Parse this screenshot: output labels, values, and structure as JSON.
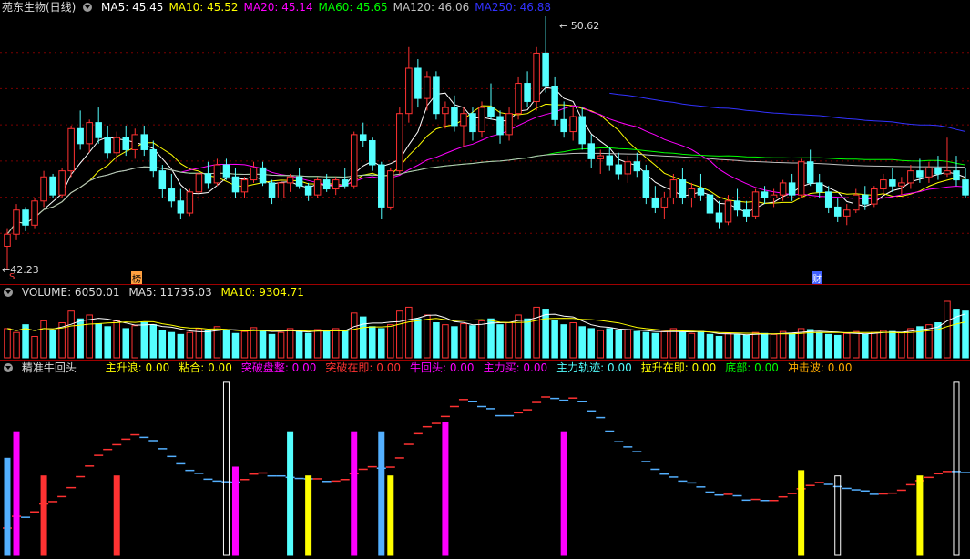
{
  "colors": {
    "up": "#ff3232",
    "down": "#54ffff",
    "ma5": "#ffffff",
    "ma10": "#ffff00",
    "ma20": "#ff00ff",
    "ma60": "#00ff00",
    "ma120": "#c0c0c0",
    "ma250": "#3232ff",
    "grid": "#7a0000",
    "border": "#a00000"
  },
  "price_panel": {
    "title": "苑东生物(日线)",
    "indicators": [
      {
        "label": "MA5: 45.45",
        "color": "#ffffff"
      },
      {
        "label": "MA10: 45.52",
        "color": "#ffff00"
      },
      {
        "label": "MA20: 45.14",
        "color": "#ff00ff"
      },
      {
        "label": "MA60: 45.65",
        "color": "#00ff00"
      },
      {
        "label": "MA120: 46.06",
        "color": "#c0c0c0"
      },
      {
        "label": "MA250: 46.88",
        "color": "#3232ff"
      }
    ],
    "high_label": "50.62",
    "low_label": "42.23",
    "event_markers": [
      "S",
      "榜",
      "财"
    ]
  },
  "volume_panel": {
    "title": "VOLUME: 6050.01",
    "ma5": "MA5: 11735.03",
    "ma10": "MA10: 9304.71"
  },
  "indicator_panel": {
    "title": "精准牛回头",
    "items": [
      {
        "label": "主升浪: 0.00",
        "color": "#ffff00"
      },
      {
        "label": "粘合: 0.00",
        "color": "#ffff00"
      },
      {
        "label": "突破盘整: 0.00",
        "color": "#ff00ff"
      },
      {
        "label": "突破在即: 0.00",
        "color": "#ff3232"
      },
      {
        "label": "牛回头: 0.00",
        "color": "#ff00ff"
      },
      {
        "label": "主力买: 0.00",
        "color": "#ff00ff"
      },
      {
        "label": "主力轨迹: 0.00",
        "color": "#54ffff"
      },
      {
        "label": "拉升在即: 0.00",
        "color": "#ffff00"
      },
      {
        "label": "底部: 0.00",
        "color": "#00ff00"
      },
      {
        "label": "冲击波: 0.00",
        "color": "#ffaa00"
      }
    ]
  },
  "chart_data": {
    "type": "candlestick",
    "ylim": [
      42.23,
      50.62
    ],
    "candles": [
      [
        43.0,
        43.6,
        42.2,
        43.4
      ],
      [
        43.4,
        44.4,
        43.2,
        44.2
      ],
      [
        44.2,
        44.3,
        43.5,
        43.7
      ],
      [
        43.7,
        44.6,
        43.6,
        44.5
      ],
      [
        44.5,
        45.5,
        44.3,
        45.3
      ],
      [
        45.3,
        45.4,
        44.6,
        44.7
      ],
      [
        44.7,
        45.6,
        44.6,
        45.5
      ],
      [
        45.5,
        47.0,
        45.3,
        46.9
      ],
      [
        46.9,
        47.5,
        46.2,
        46.4
      ],
      [
        46.4,
        47.2,
        46.1,
        47.1
      ],
      [
        47.1,
        47.6,
        46.4,
        46.6
      ],
      [
        46.6,
        47.0,
        45.9,
        46.1
      ],
      [
        46.1,
        46.8,
        45.8,
        46.6
      ],
      [
        46.6,
        47.0,
        46.0,
        46.2
      ],
      [
        46.2,
        46.9,
        45.9,
        46.7
      ],
      [
        46.7,
        47.0,
        46.0,
        46.2
      ],
      [
        46.2,
        46.5,
        45.3,
        45.5
      ],
      [
        45.5,
        45.7,
        44.6,
        44.9
      ],
      [
        44.9,
        45.4,
        44.3,
        44.5
      ],
      [
        44.5,
        44.9,
        43.9,
        44.1
      ],
      [
        44.1,
        44.9,
        44.0,
        44.8
      ],
      [
        44.8,
        45.5,
        44.5,
        45.4
      ],
      [
        45.4,
        45.8,
        44.9,
        45.1
      ],
      [
        45.1,
        45.9,
        45.0,
        45.7
      ],
      [
        45.7,
        45.9,
        45.2,
        45.3
      ],
      [
        45.3,
        45.6,
        44.6,
        44.8
      ],
      [
        44.8,
        45.3,
        44.6,
        45.2
      ],
      [
        45.2,
        45.8,
        45.1,
        45.6
      ],
      [
        45.6,
        45.8,
        45.0,
        45.1
      ],
      [
        45.1,
        45.2,
        44.4,
        44.6
      ],
      [
        44.6,
        45.2,
        44.5,
        45.1
      ],
      [
        45.1,
        45.4,
        44.8,
        45.3
      ],
      [
        45.3,
        45.6,
        44.9,
        45.0
      ],
      [
        45.0,
        45.1,
        44.5,
        44.7
      ],
      [
        44.7,
        45.3,
        44.6,
        45.2
      ],
      [
        45.2,
        45.4,
        44.8,
        44.9
      ],
      [
        44.9,
        45.3,
        44.7,
        45.2
      ],
      [
        45.2,
        45.6,
        44.9,
        45.0
      ],
      [
        45.0,
        46.8,
        44.9,
        46.7
      ],
      [
        46.7,
        47.1,
        46.3,
        46.5
      ],
      [
        46.5,
        46.6,
        45.5,
        45.7
      ],
      [
        45.7,
        45.8,
        43.9,
        44.3
      ],
      [
        44.3,
        45.6,
        44.2,
        45.5
      ],
      [
        45.5,
        47.6,
        45.4,
        47.4
      ],
      [
        47.4,
        49.6,
        47.1,
        48.9
      ],
      [
        48.9,
        49.2,
        47.6,
        47.9
      ],
      [
        47.9,
        48.8,
        47.5,
        48.6
      ],
      [
        48.6,
        48.8,
        47.2,
        47.4
      ],
      [
        47.4,
        47.8,
        46.9,
        47.6
      ],
      [
        47.6,
        48.0,
        46.8,
        47.0
      ],
      [
        47.0,
        47.6,
        46.3,
        47.4
      ],
      [
        47.4,
        47.6,
        46.5,
        46.8
      ],
      [
        46.8,
        47.8,
        46.6,
        47.6
      ],
      [
        47.6,
        48.4,
        47.2,
        47.3
      ],
      [
        47.3,
        47.5,
        46.4,
        46.7
      ],
      [
        46.7,
        47.6,
        46.5,
        47.4
      ],
      [
        47.4,
        48.6,
        47.2,
        48.4
      ],
      [
        48.4,
        48.8,
        47.6,
        47.8
      ],
      [
        47.8,
        49.6,
        47.5,
        49.4
      ],
      [
        49.4,
        50.62,
        48.1,
        48.3
      ],
      [
        48.3,
        48.6,
        47.0,
        47.2
      ],
      [
        47.2,
        47.8,
        46.6,
        46.8
      ],
      [
        46.8,
        47.6,
        46.5,
        47.3
      ],
      [
        47.3,
        47.6,
        46.2,
        46.4
      ],
      [
        46.4,
        46.7,
        45.6,
        45.9
      ],
      [
        45.9,
        46.2,
        45.4,
        46.0
      ],
      [
        46.0,
        46.3,
        45.5,
        45.7
      ],
      [
        45.7,
        46.1,
        45.2,
        45.4
      ],
      [
        45.4,
        46.0,
        45.1,
        45.8
      ],
      [
        45.8,
        46.1,
        45.3,
        45.5
      ],
      [
        45.5,
        45.7,
        44.4,
        44.6
      ],
      [
        44.6,
        45.0,
        44.1,
        44.3
      ],
      [
        44.3,
        44.8,
        43.9,
        44.6
      ],
      [
        44.6,
        45.4,
        44.4,
        45.2
      ],
      [
        45.2,
        45.6,
        44.4,
        44.6
      ],
      [
        44.6,
        45.1,
        44.3,
        44.9
      ],
      [
        44.9,
        45.4,
        44.5,
        44.7
      ],
      [
        44.7,
        44.9,
        43.9,
        44.1
      ],
      [
        44.1,
        44.5,
        43.6,
        43.8
      ],
      [
        43.8,
        44.7,
        43.7,
        44.5
      ],
      [
        44.5,
        44.9,
        44.0,
        44.2
      ],
      [
        44.2,
        44.5,
        43.8,
        44.0
      ],
      [
        44.0,
        44.9,
        43.9,
        44.8
      ],
      [
        44.8,
        45.0,
        44.4,
        44.6
      ],
      [
        44.6,
        44.9,
        44.3,
        44.7
      ],
      [
        44.7,
        45.2,
        44.5,
        45.1
      ],
      [
        45.1,
        45.4,
        44.5,
        44.7
      ],
      [
        44.7,
        45.9,
        44.6,
        45.8
      ],
      [
        45.8,
        46.2,
        45.0,
        45.1
      ],
      [
        45.1,
        45.4,
        44.6,
        44.8
      ],
      [
        44.8,
        45.0,
        44.1,
        44.3
      ],
      [
        44.3,
        44.6,
        43.8,
        44.0
      ],
      [
        44.0,
        44.4,
        43.7,
        44.2
      ],
      [
        44.2,
        44.9,
        44.1,
        44.7
      ],
      [
        44.7,
        45.0,
        44.2,
        44.4
      ],
      [
        44.4,
        45.0,
        44.3,
        44.9
      ],
      [
        44.9,
        45.4,
        44.7,
        45.2
      ],
      [
        45.2,
        45.6,
        44.8,
        45.0
      ],
      [
        45.0,
        45.3,
        44.7,
        45.1
      ],
      [
        45.1,
        45.7,
        44.9,
        45.5
      ],
      [
        45.5,
        45.9,
        45.1,
        45.3
      ],
      [
        45.3,
        45.8,
        45.1,
        45.6
      ],
      [
        45.6,
        46.0,
        45.2,
        45.4
      ],
      [
        45.4,
        46.6,
        45.3,
        45.5
      ],
      [
        45.5,
        46.0,
        45.0,
        45.2
      ],
      [
        45.2,
        45.6,
        44.6,
        44.7
      ]
    ],
    "volume": [
      30,
      26,
      34,
      22,
      38,
      28,
      36,
      48,
      40,
      44,
      35,
      32,
      38,
      30,
      33,
      36,
      34,
      28,
      26,
      24,
      26,
      30,
      28,
      32,
      29,
      25,
      27,
      31,
      28,
      24,
      26,
      30,
      28,
      25,
      29,
      27,
      30,
      28,
      46,
      42,
      32,
      30,
      34,
      48,
      52,
      40,
      44,
      36,
      34,
      32,
      35,
      33,
      38,
      40,
      34,
      36,
      44,
      40,
      52,
      50,
      38,
      34,
      36,
      32,
      30,
      28,
      30,
      28,
      29,
      27,
      26,
      25,
      27,
      30,
      26,
      25,
      27,
      24,
      22,
      25,
      24,
      23,
      26,
      25,
      24,
      27,
      25,
      30,
      29,
      26,
      24,
      23,
      25,
      27,
      24,
      26,
      28,
      27,
      26,
      30,
      32,
      34,
      36,
      58,
      50,
      48
    ]
  }
}
